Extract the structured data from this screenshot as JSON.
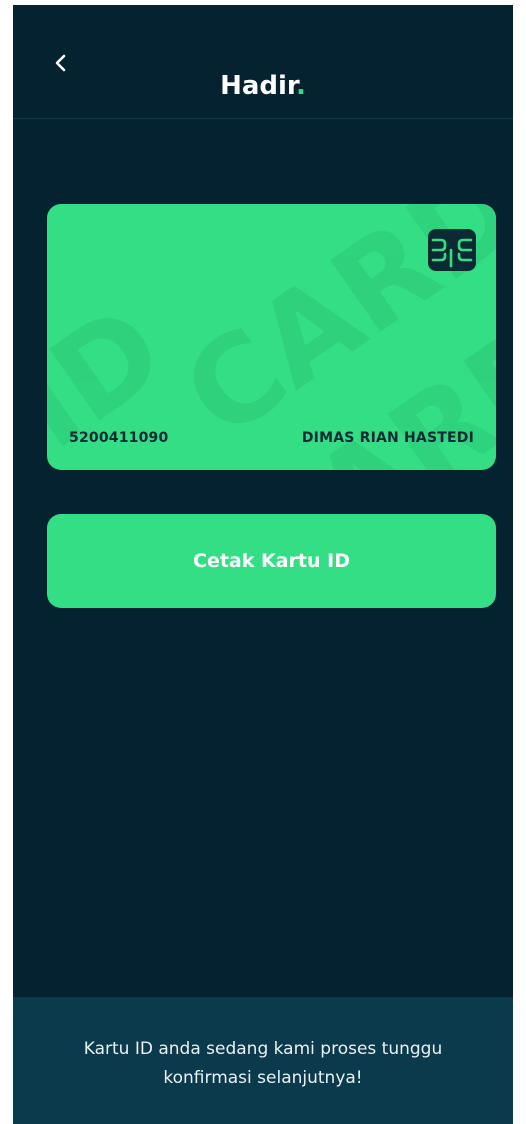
{
  "header": {
    "title": "Hadir",
    "title_dot": ".",
    "back_icon": "chevron-left-icon"
  },
  "card": {
    "number": "5200411090",
    "name": "DIMAS RIAN HASTEDI",
    "chip_icon": "sim-chip-icon",
    "watermark": "ID CARD"
  },
  "actions": {
    "print_label": "Cetak Kartu ID"
  },
  "footer": {
    "message": "Kartu ID anda sedang kami proses tunggu konfirmasi selanjutnya!"
  },
  "colors": {
    "background": "#042230",
    "accent": "#34de85",
    "footer_bg": "#0b3a4d",
    "card_text": "#0b2a33"
  }
}
